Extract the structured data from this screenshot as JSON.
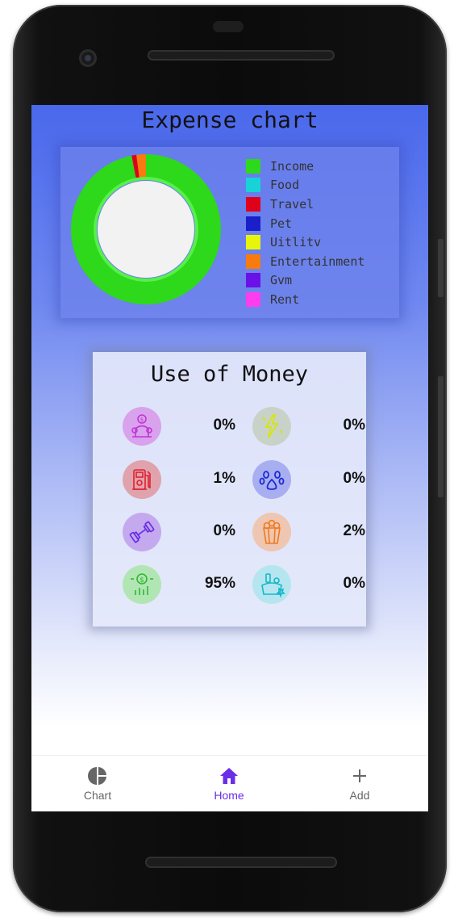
{
  "header": {
    "title": "Expense chart"
  },
  "chart_data": {
    "type": "pie",
    "legend_position": "right",
    "categories": [
      "Income",
      "Food",
      "Travel",
      "Pet",
      "Uitlitv",
      "Entertainment",
      "Gvm",
      "Rent"
    ],
    "values": [
      95,
      0,
      1,
      0,
      0,
      2,
      0,
      0
    ],
    "colors": [
      "#2ed81a",
      "#17d3d8",
      "#e0001a",
      "#1a1fc9",
      "#e6f50a",
      "#f77b0e",
      "#6a11e8",
      "#ff3df0"
    ]
  },
  "money": {
    "title": "Use of Money",
    "items": [
      {
        "icon": "salary-person-icon",
        "percent": "0%",
        "bg": "#d9a2ec",
        "color": "#c235d6"
      },
      {
        "icon": "lightning-icon",
        "percent": "0%",
        "bg": "#c9d2c8",
        "color": "#d8e600"
      },
      {
        "icon": "gas-pump-icon",
        "percent": "1%",
        "bg": "#e0a3ad",
        "color": "#e0202e"
      },
      {
        "icon": "paw-print-icon",
        "percent": "0%",
        "bg": "#a8aef0",
        "color": "#1a2ad0"
      },
      {
        "icon": "dumbbell-icon",
        "percent": "0%",
        "bg": "#c4a9ef",
        "color": "#6a2ee6"
      },
      {
        "icon": "popcorn-icon",
        "percent": "2%",
        "bg": "#eec6b2",
        "color": "#f07a1c"
      },
      {
        "icon": "money-growth-icon",
        "percent": "95%",
        "bg": "#b1e6b4",
        "color": "#2fb82f"
      },
      {
        "icon": "groceries-icon",
        "percent": "0%",
        "bg": "#b5e6ef",
        "color": "#16b6c8"
      }
    ]
  },
  "nav": {
    "items": [
      {
        "label": "Chart",
        "icon": "pie-chart-icon"
      },
      {
        "label": "Home",
        "icon": "home-icon"
      },
      {
        "label": "Add",
        "icon": "plus-icon"
      }
    ],
    "active": "Home"
  }
}
